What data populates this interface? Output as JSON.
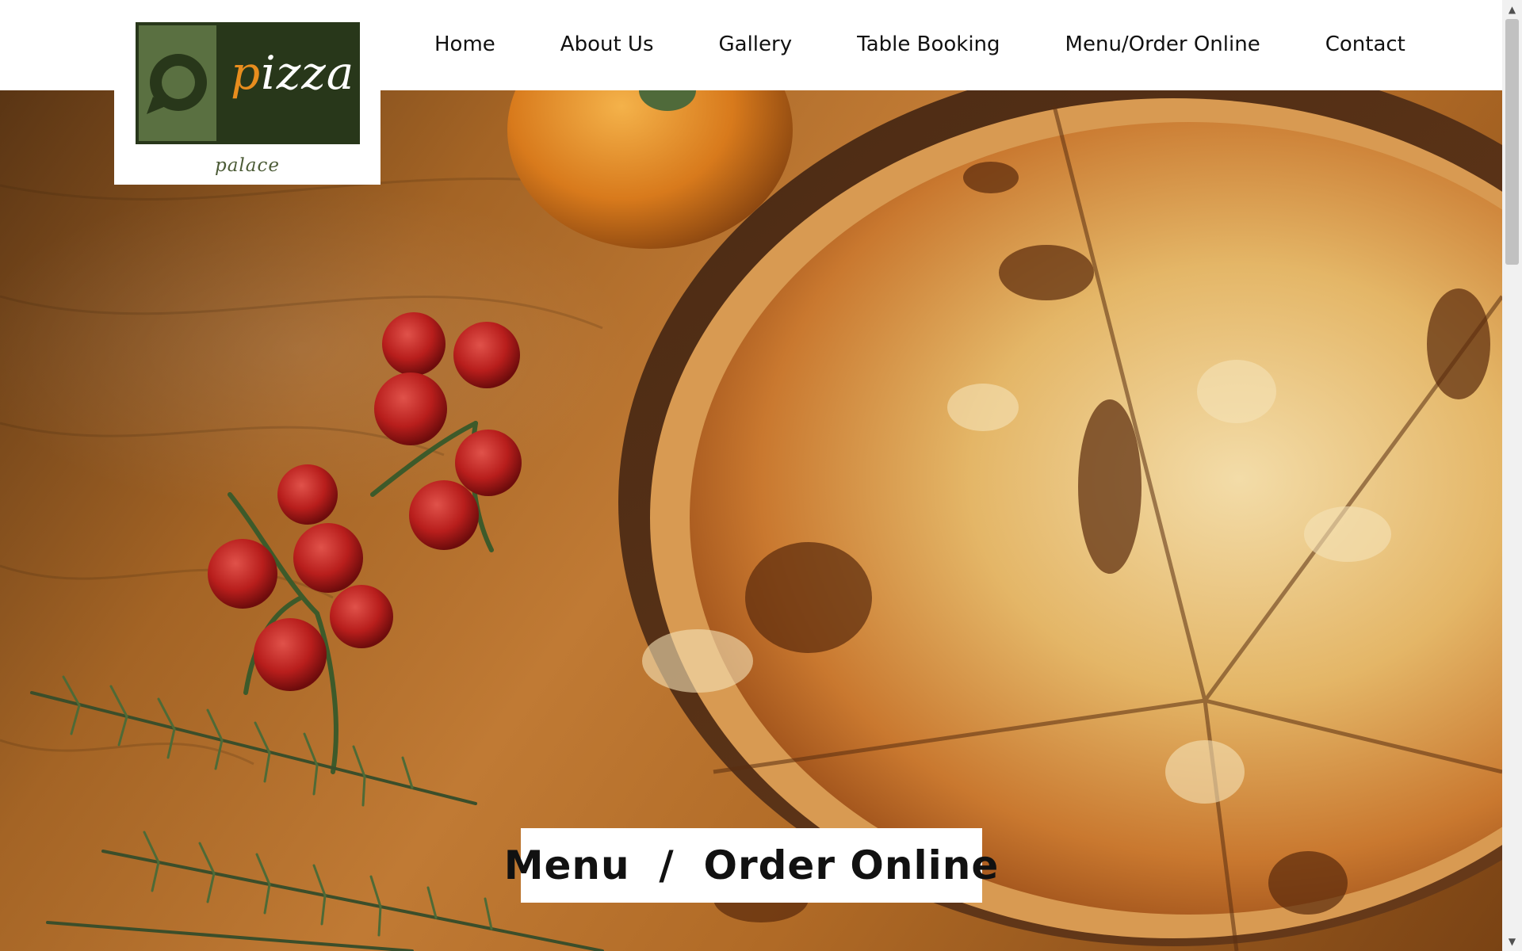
{
  "logo": {
    "word_first": "p",
    "word_rest": "izza",
    "subtitle": "palace",
    "icon": "speech-bubble-icon",
    "colors": {
      "box": "#28371a",
      "tile": "#5a7041",
      "accent": "#e88d1e"
    }
  },
  "nav": {
    "items": [
      {
        "label": "Home"
      },
      {
        "label": "About Us"
      },
      {
        "label": "Gallery"
      },
      {
        "label": "Table Booking"
      },
      {
        "label": "Menu/Order Online"
      },
      {
        "label": "Contact"
      }
    ]
  },
  "hero": {
    "caption": "Menu  /  Order Online",
    "image": "pizza-on-wooden-board-with-cherry-tomatoes-and-rosemary"
  },
  "scrollbar": {
    "up_icon": "scroll-up-arrow-icon",
    "down_icon": "scroll-down-arrow-icon"
  }
}
